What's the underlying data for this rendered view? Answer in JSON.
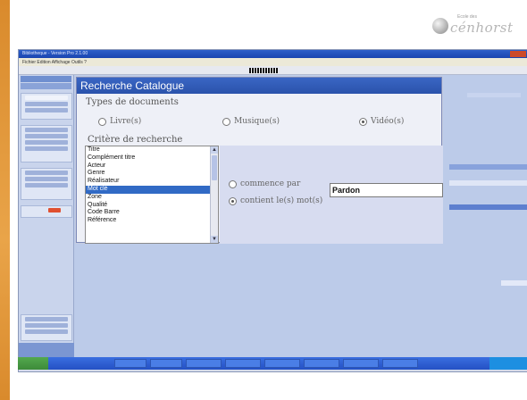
{
  "logo": {
    "text": "cénhorst",
    "small": "Ecole des"
  },
  "app": {
    "title": "Bibliotheque - Version Pro 2.1.00",
    "menu": "Fichier   Edition   Affichage   Outils   ?"
  },
  "dialog": {
    "title": "Recherche Catalogue",
    "doc_types_label": "Types de documents",
    "doc_types": [
      {
        "label": "Livre(s)",
        "selected": false
      },
      {
        "label": "Musique(s)",
        "selected": false
      },
      {
        "label": "Vidéo(s)",
        "selected": true
      }
    ],
    "criteria_label": "Critère de recherche",
    "criteria": [
      "Titre",
      "Complément titre",
      "Acteur",
      "Genre",
      "Réalisateur",
      "Mot clé",
      "Zone",
      "Qualité",
      "Code Barre",
      "Référence"
    ],
    "selected_criterion": "Mot clé",
    "match_modes": [
      {
        "label": "commence par",
        "selected": false
      },
      {
        "label": "contient le(s) mot(s)",
        "selected": true
      }
    ],
    "search_value": "Pardon"
  },
  "colors": {
    "accent": "#316ac5",
    "title_bar": "#2a52ab",
    "orange": "#e9a449"
  }
}
